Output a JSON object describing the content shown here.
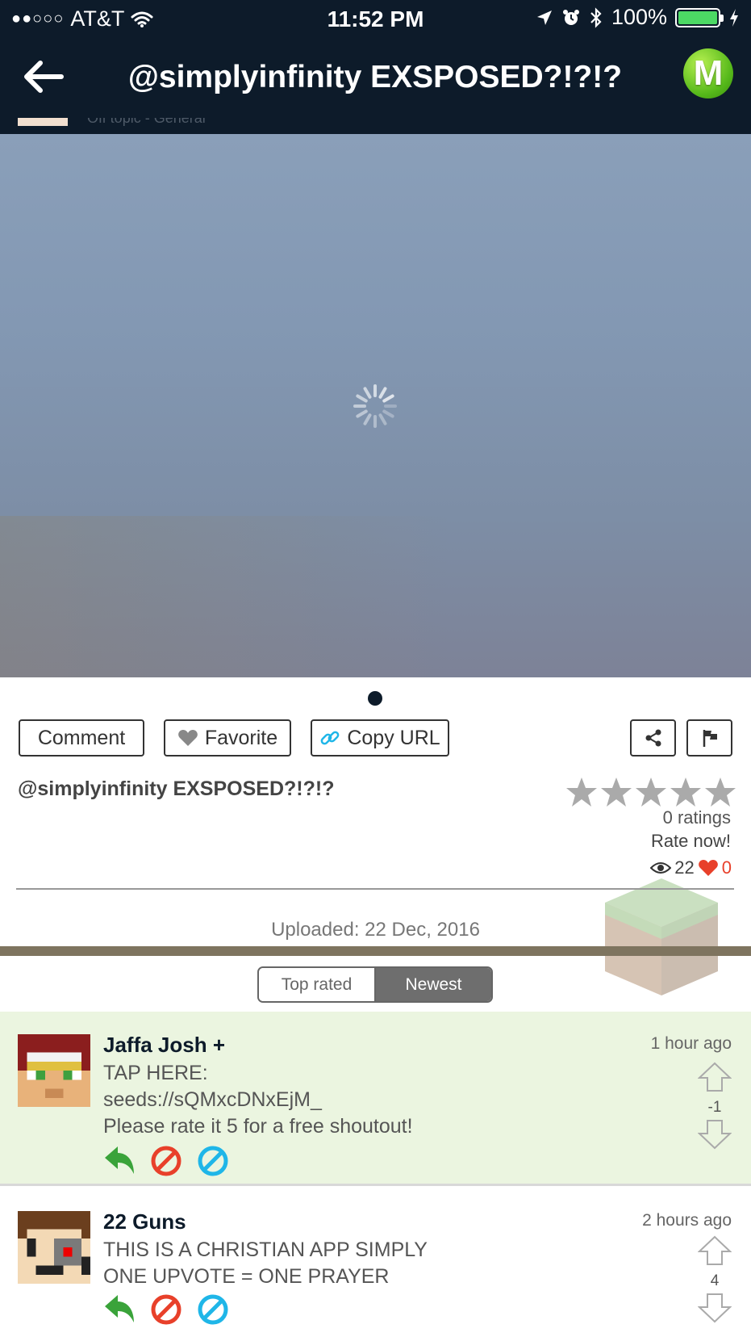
{
  "status_bar": {
    "signal": "●●○○○",
    "carrier": "AT&T",
    "time": "11:52 PM",
    "battery": "100%"
  },
  "header": {
    "title": "@simplyinfinity EXSPOSED?!?!?",
    "logo_letter": "M"
  },
  "peek_row": {
    "text": "Off topic - General"
  },
  "actions": {
    "comment": "Comment",
    "favorite": "Favorite",
    "copy_url": "Copy URL"
  },
  "post": {
    "title": "@simplyinfinity EXSPOSED?!?!?",
    "rating_stars": 0,
    "ratings": "0 ratings",
    "rate_now": "Rate now!",
    "views": "22",
    "likes": "0",
    "uploaded": "Uploaded: 22 Dec, 2016"
  },
  "sort": {
    "top_rated": "Top rated",
    "newest": "Newest",
    "active": "newest"
  },
  "comments": [
    {
      "author": "Jaffa Josh +",
      "time": "1 hour ago",
      "lines": [
        "TAP HERE:",
        "seeds://sQMxcDNxEjM_",
        "Please rate it 5 for a free shoutout!"
      ],
      "score": "-1"
    },
    {
      "author": "22 Guns",
      "time": "2 hours ago",
      "lines": [
        "THIS IS A CHRISTIAN APP SIMPLY",
        "ONE UPVOTE = ONE PRAYER"
      ],
      "score": "4"
    }
  ],
  "colors": {
    "header_bg": "#0d1b2a",
    "comment_highlight": "#ebf5e0",
    "reply_green": "#3aa33a",
    "block_red": "#e8402a",
    "block_blue": "#1fb6e8",
    "heart_red": "#e8402a"
  },
  "icons": [
    "back-arrow-icon",
    "wifi-icon",
    "location-icon",
    "alarm-icon",
    "bluetooth-icon",
    "charging-icon",
    "loading-spinner-icon",
    "heart-icon",
    "link-icon",
    "share-icon",
    "flag-icon",
    "star-icon",
    "eye-icon",
    "reply-icon",
    "block-icon",
    "upvote-icon",
    "downvote-icon"
  ]
}
